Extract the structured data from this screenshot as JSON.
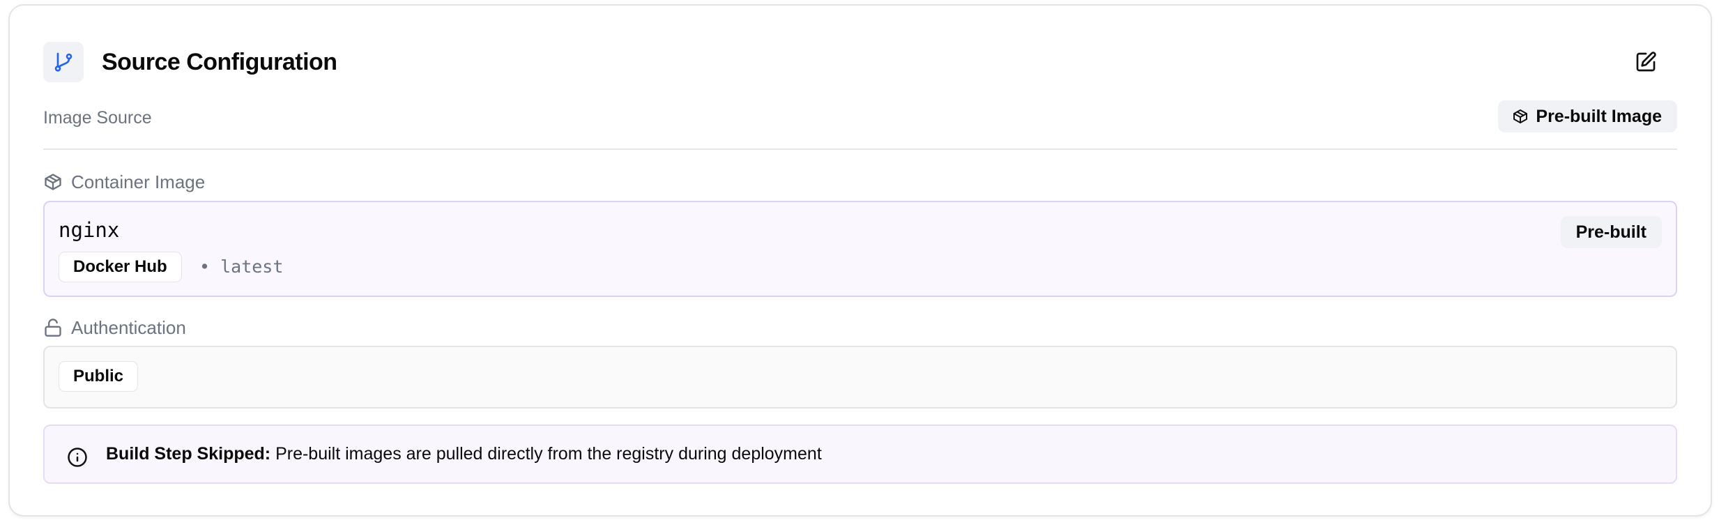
{
  "header": {
    "title": "Source Configuration",
    "icon": "git-branch-icon",
    "edit_icon": "edit-icon"
  },
  "image_source": {
    "label": "Image Source",
    "badge": "Pre-built Image",
    "badge_icon": "package-icon"
  },
  "container_image": {
    "label": "Container Image",
    "icon": "package-icon",
    "name": "nginx",
    "registry": "Docker Hub",
    "tag": "• latest",
    "type_badge": "Pre-built"
  },
  "authentication": {
    "label": "Authentication",
    "icon": "unlock-icon",
    "value": "Public"
  },
  "notice": {
    "icon": "info-icon",
    "title": "Build Step Skipped:",
    "message": " Pre-built images are pulled directly from the registry during deployment"
  },
  "colors": {
    "accent": "#2563eb",
    "muted_text": "#6b7280",
    "image_box_bg": "#faf7fe",
    "image_box_border": "#ddd0f5"
  }
}
